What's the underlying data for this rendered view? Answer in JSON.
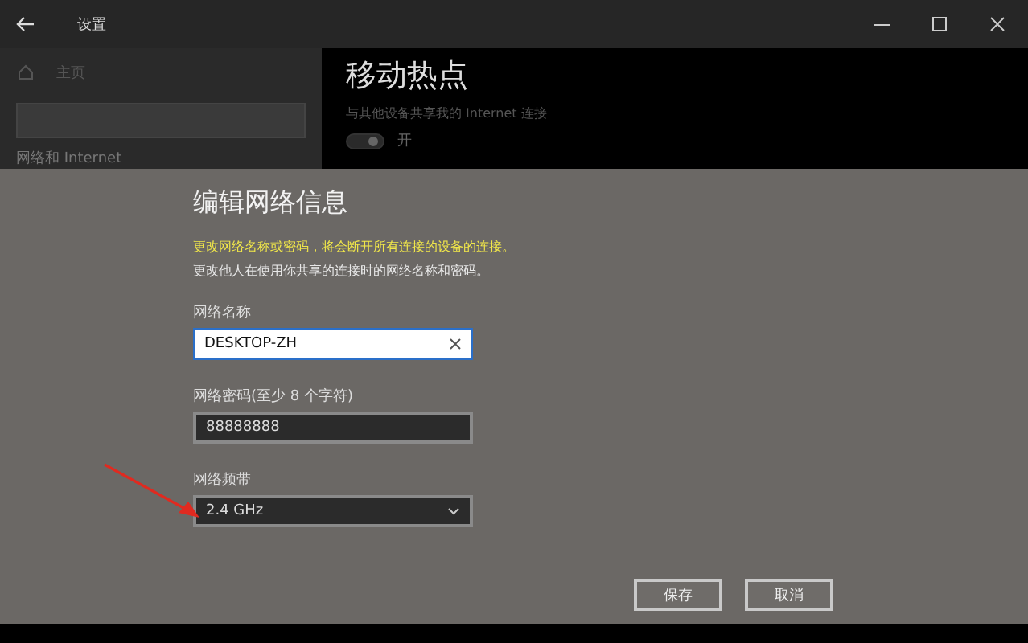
{
  "window": {
    "title": "设置"
  },
  "sidebar": {
    "home": "主页",
    "section": "网络和 Internet"
  },
  "page": {
    "title": "移动热点",
    "description": "与其他设备共享我的 Internet 连接",
    "toggle": {
      "on": true,
      "label": "开"
    }
  },
  "dialog": {
    "title": "编辑网络信息",
    "warning": "更改网络名称或密码，将会断开所有连接的设备的连接。",
    "note": "更改他人在使用你共享的连接时的网络名称和密码。",
    "fields": [
      {
        "kind": "text",
        "label": "网络名称",
        "value": "DESKTOP-ZH",
        "focused": true
      },
      {
        "kind": "text",
        "label": "网络密码(至少 8 个字符)",
        "value": "88888888",
        "focused": false
      },
      {
        "kind": "select",
        "label": "网络频带",
        "value": "2.4 GHz",
        "focused": false
      }
    ],
    "buttons": [
      "保存",
      "取消"
    ]
  }
}
